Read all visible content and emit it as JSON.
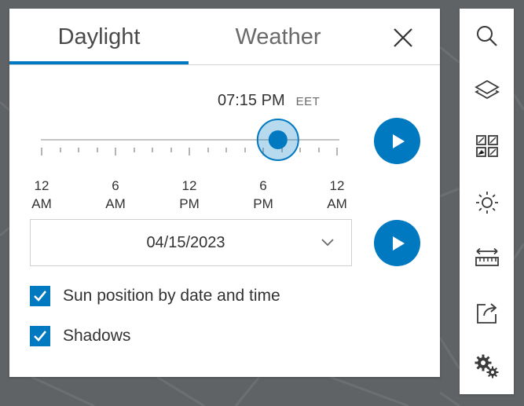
{
  "tabs": [
    {
      "label": "Daylight",
      "active": true
    },
    {
      "label": "Weather",
      "active": false
    }
  ],
  "time": {
    "value": "07:15 PM",
    "zone": "EET",
    "position_fraction": 0.8
  },
  "slider_ticks": [
    {
      "line1": "12",
      "line2": "AM"
    },
    {
      "line1": "6",
      "line2": "AM"
    },
    {
      "line1": "12",
      "line2": "PM"
    },
    {
      "line1": "6",
      "line2": "PM"
    },
    {
      "line1": "12",
      "line2": "AM"
    }
  ],
  "date": {
    "value": "04/15/2023"
  },
  "options": {
    "sun_position_label": "Sun position by date and time",
    "sun_position_checked": true,
    "shadows_label": "Shadows",
    "shadows_checked": true
  },
  "toolbar_icons": [
    "search-icon",
    "layers-icon",
    "basemap-gallery-icon",
    "daylight-icon",
    "measure-icon",
    "share-icon",
    "settings-icon"
  ],
  "colors": {
    "accent": "#0079c1",
    "text": "#323232",
    "map_background": "#606366"
  }
}
